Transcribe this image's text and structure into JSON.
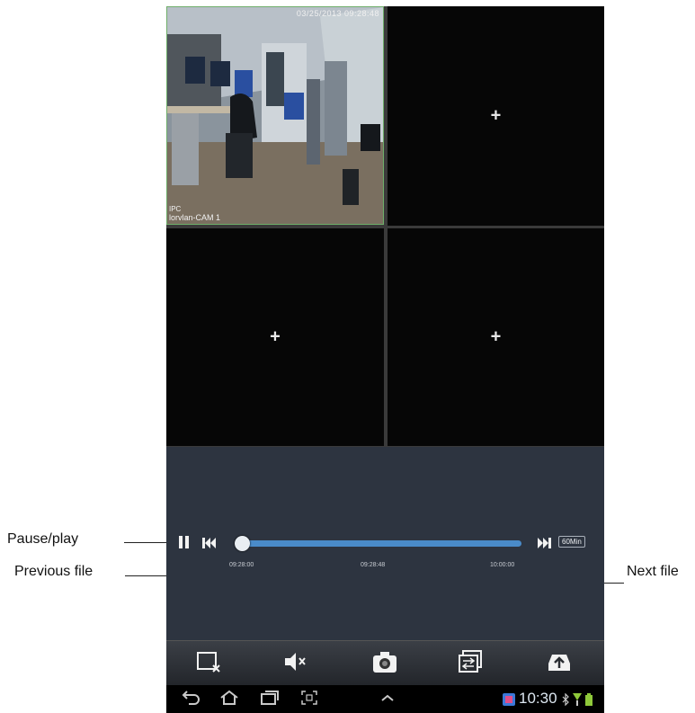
{
  "grid": {
    "camera1": {
      "timestamp": "03/25/2013 09:28:48",
      "badge": "IPC",
      "name": "lorvlan-CAM 1"
    },
    "empty_channel_symbol": "+"
  },
  "playback": {
    "start_time": "09:28:00",
    "current_time": "09:28:48",
    "end_time": "10:00:00",
    "duration_label": "60Min",
    "progress_fraction": 0.05
  },
  "toolbar": {
    "icons": [
      "close-window-icon",
      "mute-icon",
      "camera-snapshot-icon",
      "switch-layout-icon",
      "upload-icon"
    ]
  },
  "navbar": {
    "clock": "10:30",
    "icons": [
      "back-icon",
      "home-icon",
      "recent-apps-icon",
      "screenshot-icon",
      "up-chevron-icon"
    ]
  },
  "callouts": {
    "pause_play": "Pause/play",
    "previous_file": "Previous file",
    "next_file": "Next file"
  },
  "colors": {
    "progress": "#4a8bc9",
    "panel": "#2d3440",
    "active_border": "#6fae6a"
  }
}
